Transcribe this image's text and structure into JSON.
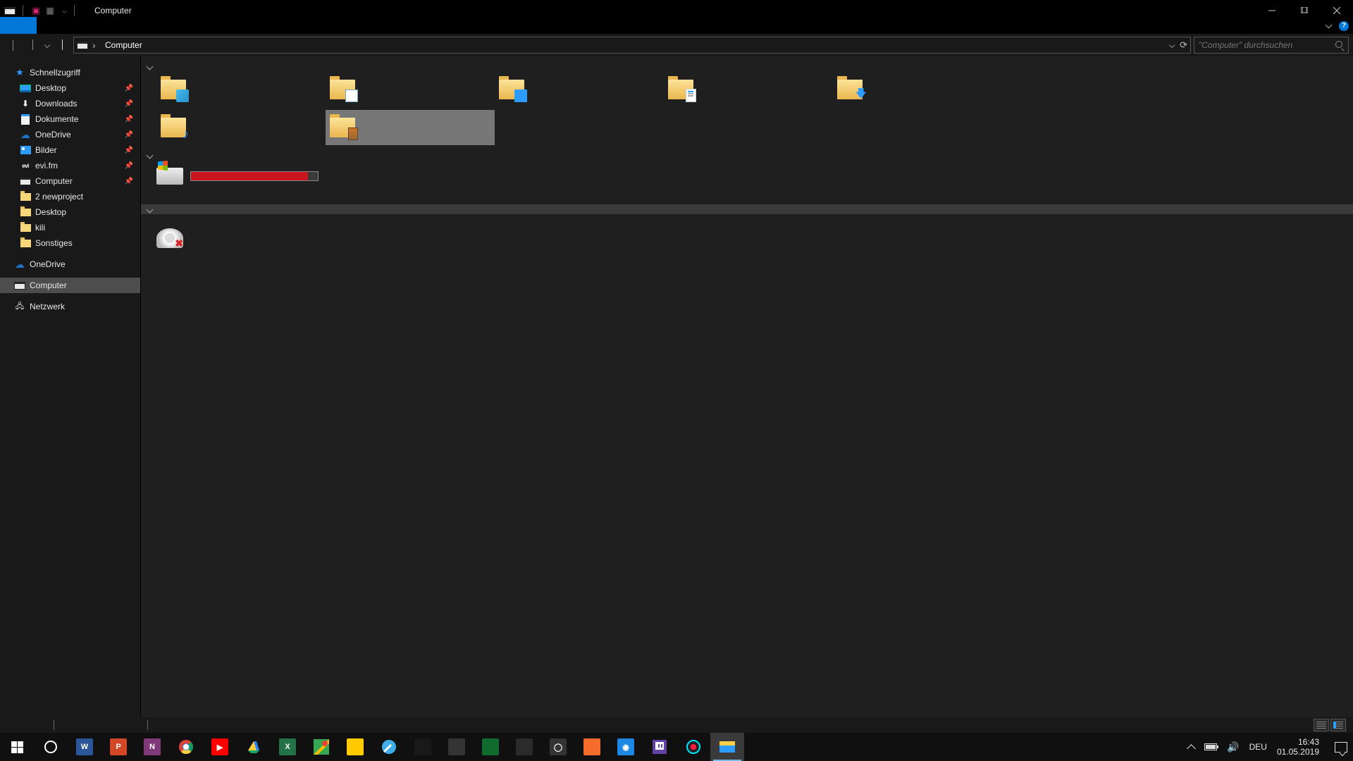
{
  "window": {
    "title": "Computer"
  },
  "address": {
    "path": "Computer"
  },
  "search": {
    "placeholder": "\"Computer\" durchsuchen"
  },
  "sidebar": {
    "quick": "Schnellzugriff",
    "items": [
      {
        "label": "Desktop",
        "icon": "desktop",
        "pin": true
      },
      {
        "label": "Downloads",
        "icon": "down",
        "pin": true
      },
      {
        "label": "Dokumente",
        "icon": "doc",
        "pin": true
      },
      {
        "label": "OneDrive",
        "icon": "cloud",
        "pin": true
      },
      {
        "label": "Bilder",
        "icon": "pic",
        "pin": true
      },
      {
        "label": "evi.fm",
        "icon": "evi",
        "pin": true
      },
      {
        "label": "Computer",
        "icon": "pc",
        "pin": true
      },
      {
        "label": "2 newproject",
        "icon": "fold",
        "pin": false
      },
      {
        "label": "Desktop",
        "icon": "fold",
        "pin": false
      },
      {
        "label": "kili",
        "icon": "fold",
        "pin": false
      },
      {
        "label": "Sonstiges",
        "icon": "fold",
        "pin": false
      }
    ],
    "onedrive": "OneDrive",
    "computer": "Computer",
    "network": "Netzwerk"
  },
  "drive": {
    "used_percent": 92
  },
  "tray": {
    "lang": "DEU",
    "time": "16:43",
    "date": "01.05.2019"
  },
  "taskbar_apps": [
    {
      "name": "word",
      "bg": "#2b579a",
      "txt": "W"
    },
    {
      "name": "powerpoint",
      "bg": "#d24726",
      "txt": "P"
    },
    {
      "name": "onenote",
      "bg": "#80397b",
      "txt": "N"
    },
    {
      "name": "chrome",
      "bg": "",
      "txt": ""
    },
    {
      "name": "youtube",
      "bg": "#ff0000",
      "txt": "▶"
    },
    {
      "name": "gdrive",
      "bg": "",
      "txt": ""
    },
    {
      "name": "excel",
      "bg": "#217346",
      "txt": "X"
    },
    {
      "name": "maps",
      "bg": "",
      "txt": ""
    },
    {
      "name": "webde",
      "bg": "#ffcc00",
      "txt": ""
    },
    {
      "name": "krita",
      "bg": "",
      "txt": ""
    },
    {
      "name": "paintnet",
      "bg": "#191919",
      "txt": ""
    },
    {
      "name": "calc",
      "bg": "#333",
      "txt": ""
    },
    {
      "name": "obs-cam",
      "bg": "#106b2f",
      "txt": ""
    },
    {
      "name": "epic",
      "bg": "#2a2a2a",
      "txt": ""
    },
    {
      "name": "obs",
      "bg": "#333",
      "txt": "◯"
    },
    {
      "name": "origin",
      "bg": "#f56c2d",
      "txt": ""
    },
    {
      "name": "app-blue",
      "bg": "#1e88e5",
      "txt": "◉"
    },
    {
      "name": "twitch",
      "bg": "#6441a5",
      "txt": ""
    },
    {
      "name": "recorder",
      "bg": "#222",
      "txt": "●"
    },
    {
      "name": "explorer",
      "bg": "#ffcf48",
      "txt": ""
    }
  ]
}
